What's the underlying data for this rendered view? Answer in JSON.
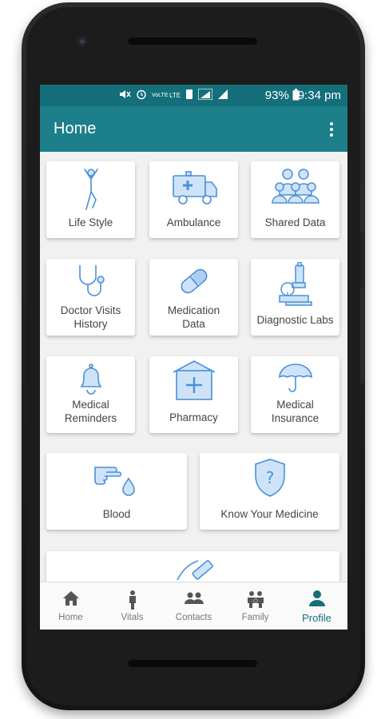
{
  "status_bar": {
    "icons": [
      "mute-icon",
      "alarm-icon",
      "volte-icon",
      "lte-icon",
      "sim-icon",
      "signal-icon",
      "signal-icon"
    ],
    "volte_label": "VoLTE",
    "lte_label": "LTE",
    "battery": "93%",
    "time": "9:34 pm"
  },
  "app_bar": {
    "title": "Home"
  },
  "tiles": [
    {
      "label": "Life Style",
      "icon": "person-stretching-icon"
    },
    {
      "label": "Ambulance",
      "icon": "ambulance-icon"
    },
    {
      "label": "Shared Data",
      "icon": "group-icon"
    },
    {
      "label_line1": "Doctor Visits",
      "label_line2": "History",
      "icon": "stethoscope-icon"
    },
    {
      "label_line1": "Medication",
      "label_line2": "Data",
      "icon": "pill-icon"
    },
    {
      "label": "Diagnostic Labs",
      "icon": "microscope-icon"
    },
    {
      "label_line1": "Medical",
      "label_line2": "Reminders",
      "icon": "bell-icon"
    },
    {
      "label": "Pharmacy",
      "icon": "pharmacy-icon"
    },
    {
      "label_line1": "Medical",
      "label_line2": "Insurance",
      "icon": "umbrella-icon"
    },
    {
      "label": "Blood",
      "icon": "blood-drop-hand-icon"
    },
    {
      "label": "Know Your Medicine",
      "icon": "shield-question-icon"
    }
  ],
  "bottom_nav": [
    {
      "label": "Home",
      "icon": "home-icon",
      "active": false
    },
    {
      "label": "Vitals",
      "icon": "person-icon",
      "active": false
    },
    {
      "label": "Contacts",
      "icon": "contacts-icon",
      "active": false
    },
    {
      "label": "Family",
      "icon": "family-icon",
      "active": false
    },
    {
      "label": "Profile",
      "icon": "profile-icon",
      "active": true
    }
  ],
  "colors": {
    "primary": "#1c7f8a",
    "primary_dark": "#146f7a",
    "icon_stroke": "#4a90d9",
    "icon_fill": "#cfe3f8"
  }
}
